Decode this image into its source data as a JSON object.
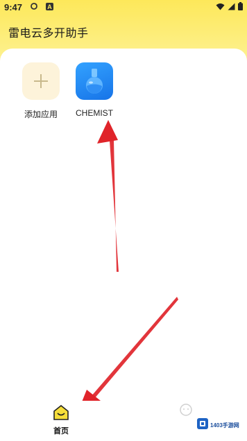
{
  "status_bar": {
    "time": "9:47",
    "notification_letter": "A"
  },
  "header": {
    "title": "雷电云多开助手"
  },
  "apps": [
    {
      "label": "添加应用",
      "icon": "plus-icon"
    },
    {
      "label": "CHEMIST",
      "icon": "flask-icon"
    }
  ],
  "bottom_nav": {
    "home_label": "首页",
    "me_icon": "person-icon"
  },
  "watermark": {
    "text": "1403手游网",
    "logo": "1403-logo"
  },
  "colors": {
    "header_yellow": "#fde85a",
    "accent_blue": "#1774e8",
    "arrow_red": "#e0242a"
  }
}
